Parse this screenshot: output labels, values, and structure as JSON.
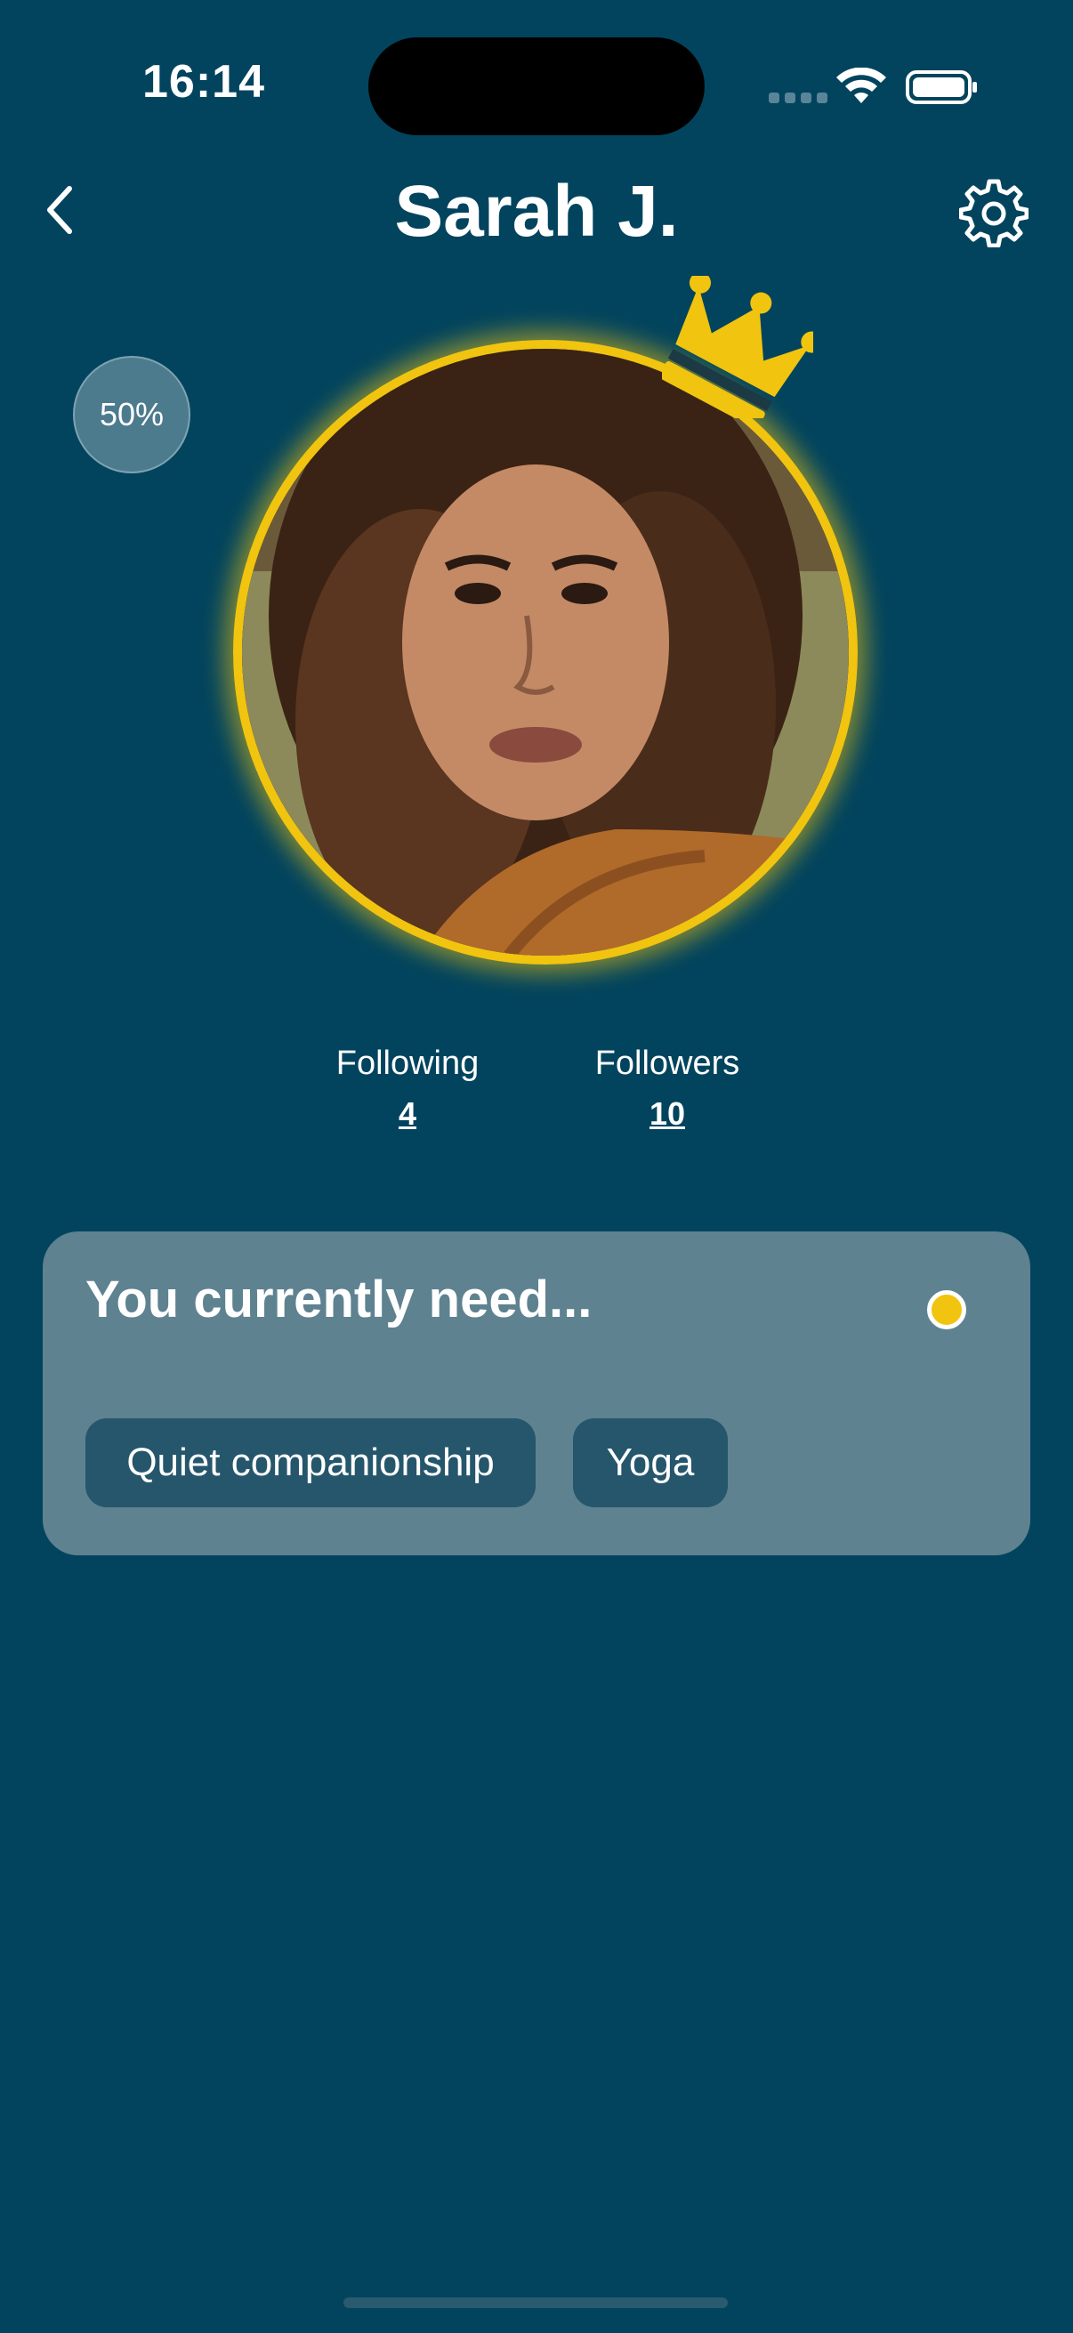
{
  "status_bar": {
    "time": "16:14"
  },
  "header": {
    "title": "Sarah J.",
    "back_icon": "chevron-left-icon",
    "settings_icon": "gear-icon"
  },
  "profile": {
    "progress_label": "50%",
    "crown_icon": "crown-icon",
    "avatar_alt": "profile photo"
  },
  "stats": [
    {
      "label": "Following",
      "value": "4"
    },
    {
      "label": "Followers",
      "value": "10"
    }
  ],
  "needs_card": {
    "title": "You currently need...",
    "status_color": "#f1c40f",
    "chips": [
      {
        "label": "Quiet companionship"
      },
      {
        "label": "Yoga"
      }
    ]
  },
  "colors": {
    "background": "#02445e",
    "accent": "#f1c40f",
    "card": "#5e8290",
    "chip": "#25566c"
  }
}
